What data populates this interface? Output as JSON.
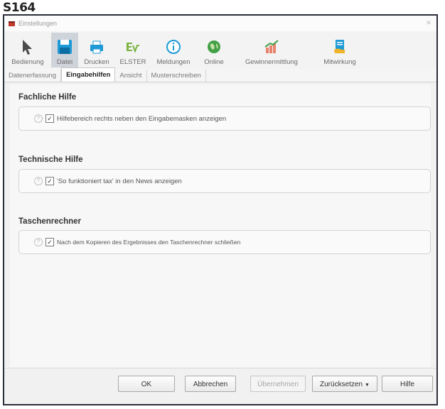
{
  "page_label": "S164",
  "window": {
    "title": "Einstellungen",
    "close_glyph": "×"
  },
  "toolbar": {
    "items": [
      {
        "label": "Bedienung",
        "icon": "pointer-arrow-icon"
      },
      {
        "label": "Datei",
        "icon": "floppy-disk-icon",
        "active": true
      },
      {
        "label": "Drucken",
        "icon": "printer-icon"
      },
      {
        "label": "ELSTER",
        "icon": "elster-logo-icon"
      },
      {
        "label": "Meldungen",
        "icon": "info-icon"
      },
      {
        "label": "Online",
        "icon": "globe-icon"
      },
      {
        "label": "Gewinnermittlung",
        "icon": "bar-chart-icon"
      },
      {
        "label": "Mitwirkung",
        "icon": "document-hand-icon"
      }
    ]
  },
  "subtabs": [
    {
      "label": "Datenerfassung"
    },
    {
      "label": "Eingabehilfen",
      "active": true
    },
    {
      "label": "Ansicht"
    },
    {
      "label": "Musterschreiben"
    }
  ],
  "sections": [
    {
      "title": "Fachliche Hilfe",
      "option": "Hilfebereich rechts neben den Eingabemasken anzeigen",
      "checked": true
    },
    {
      "title": "Technische Hilfe",
      "option": "'So funktioniert tax' in den News anzeigen",
      "checked": true
    },
    {
      "title": "Taschenrechner",
      "option": "Nach dem Kopieren des Ergebnisses den Taschenrechner schließen",
      "checked": true
    }
  ],
  "buttons": {
    "ok": "OK",
    "cancel": "Abbrechen",
    "apply": "Übernehmen",
    "reset": "Zurücksetzen",
    "help": "Hilfe"
  },
  "colors": {
    "active_tool_bg": "#cfd3da",
    "frame_border": "#2b2f3a"
  }
}
